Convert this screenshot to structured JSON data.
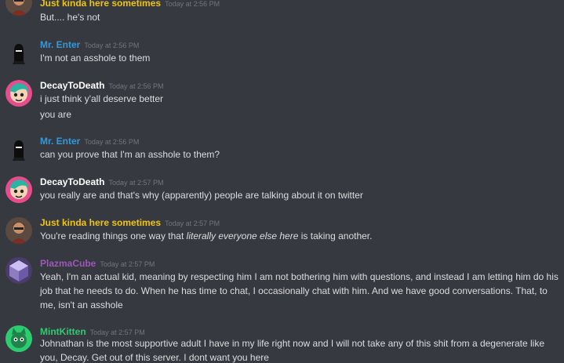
{
  "colors": {
    "background": "#36393f",
    "yellow_user": "#f1c40f",
    "blue_user": "#3498db",
    "white_user": "#ffffff",
    "purple_user": "#9b59b6",
    "green_user": "#2ecc71",
    "timestamp": "#72767d",
    "text": "#dcddde"
  },
  "messages": [
    {
      "author": "Just kinda here sometimes",
      "timestamp": "Today at 2:56 PM",
      "lines": [
        "But.... he's not"
      ]
    },
    {
      "author": "Mr. Enter",
      "timestamp": "Today at 2:56 PM",
      "lines": [
        "I'm not an asshole to them"
      ]
    },
    {
      "author": "DecayToDeath",
      "timestamp": "Today at 2:56 PM",
      "lines": [
        "i just think y'all deserve better",
        "you are"
      ]
    },
    {
      "author": "Mr. Enter",
      "timestamp": "Today at 2:56 PM",
      "lines": [
        "can you prove that I'm an asshole to them?"
      ]
    },
    {
      "author": "DecayToDeath",
      "timestamp": "Today at 2:57 PM",
      "lines": [
        "you really are and that's why (apparently) people are talking about it on twitter"
      ]
    },
    {
      "author": "Just kinda here sometimes",
      "timestamp": "Today at 2:57 PM",
      "text_before": "You're reading things one way that ",
      "text_italic": "literally everyone else here",
      "text_after": " is taking another."
    },
    {
      "author": "PlazmaCube",
      "timestamp": "Today at 2:57 PM",
      "lines": [
        "Yeah, I'm an actual kid, meaning by respecting him I am not bothering him with questions, and instead I am letting him do his job that he needs to do. When he has time to chat, I occasionally chat with him. And we have good conversations. That, to me, isn't an asshole"
      ]
    },
    {
      "author": "MintKitten",
      "timestamp": "Today at 2:57 PM",
      "lines": [
        "Johnathan is the most supportive adult I have in my life right now and I will not take any of this shit from a degenerate like you, Decay. Get out of this server. I dont want you here"
      ]
    }
  ]
}
